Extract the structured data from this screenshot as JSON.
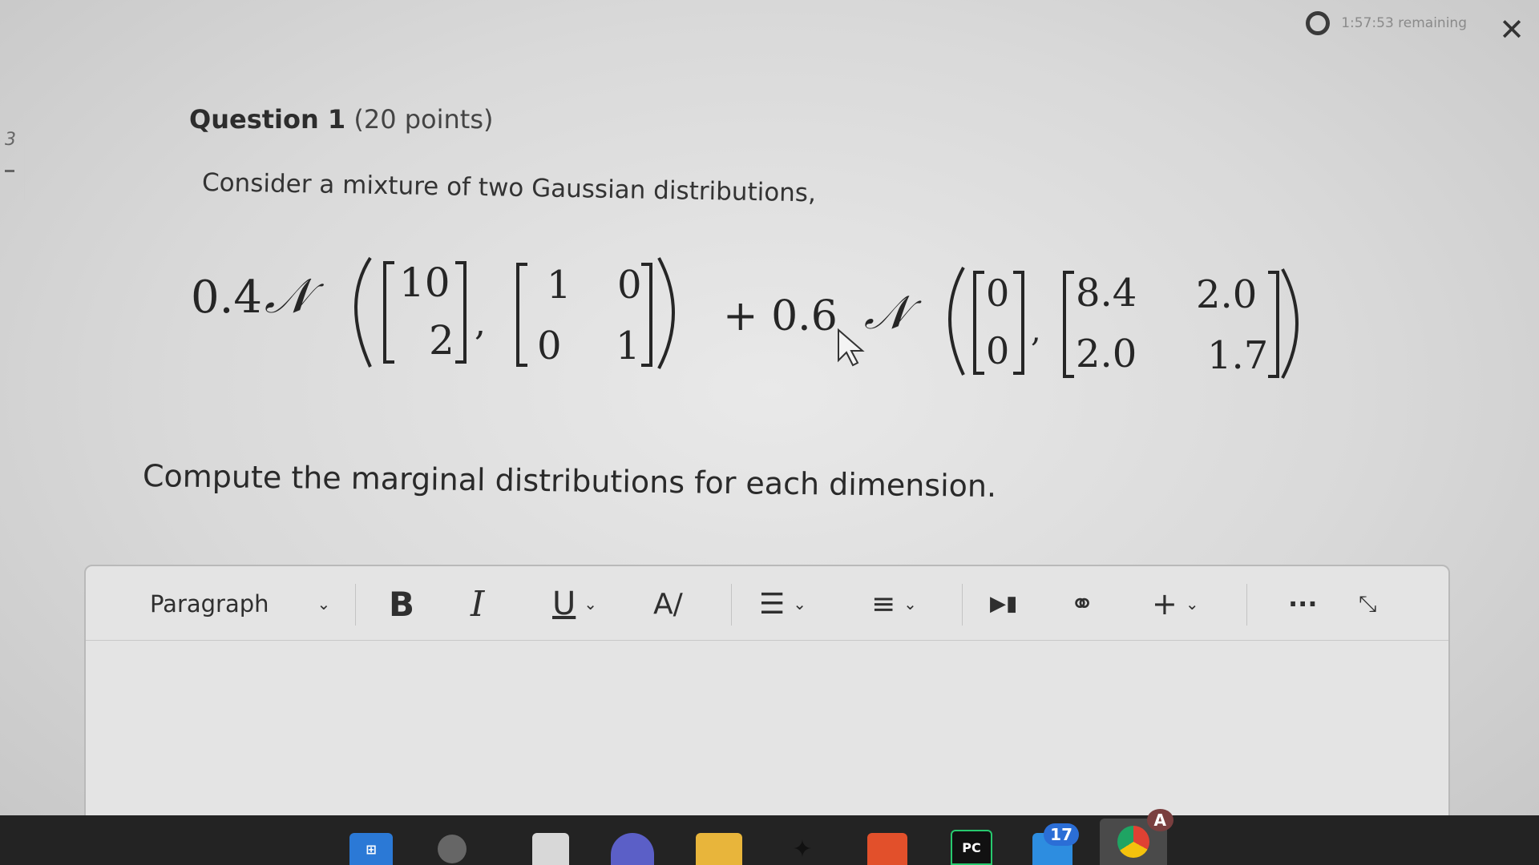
{
  "timer": {
    "text": "1:57:53 remaining"
  },
  "left_tab": {
    "number": "3"
  },
  "question": {
    "title_bold": "Question 1",
    "points": "(20 points)",
    "prompt": "Consider a mixture of two Gaussian distributions,",
    "task": "Compute the marginal distributions for each dimension."
  },
  "formula": {
    "weight1": "0.4",
    "normal_symbol": "𝒩",
    "mean1": [
      "10",
      "2"
    ],
    "cov1": [
      [
        "1",
        "0"
      ],
      [
        "0",
        "1"
      ]
    ],
    "plus_weight2": "+ 0.6",
    "mean2": [
      "0",
      "0"
    ],
    "cov2": [
      [
        "8.4",
        "2.0"
      ],
      [
        "2.0",
        "1.7"
      ]
    ]
  },
  "editor": {
    "block_style": "Paragraph",
    "toolbar_icons": [
      "chevron-down-icon",
      "bold-icon",
      "italic-icon",
      "underline-icon",
      "text-color-icon",
      "align-icon",
      "list-icon",
      "media-icon",
      "link-icon",
      "plus-icon",
      "more-icon",
      "fullscreen-icon"
    ]
  },
  "taskbar": {
    "icons": [
      "windows-start-icon",
      "search-icon",
      "file-icon",
      "teams-icon",
      "folder-icon",
      "dropbox-icon",
      "brave-icon",
      "pycharm-icon",
      "mail-icon",
      "chrome-icon"
    ],
    "pycharm_label": "PC",
    "mail_badge": "17",
    "chrome_profile": "A"
  }
}
